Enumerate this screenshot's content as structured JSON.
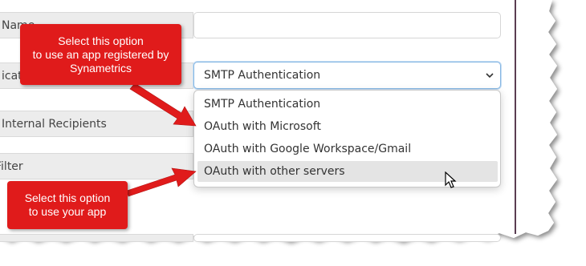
{
  "form": {
    "rows": [
      {
        "label": "Name"
      },
      {
        "label": "ication"
      },
      {
        "label": "Internal Recipients"
      },
      {
        "label": "Filter"
      }
    ]
  },
  "auth_select": {
    "value": "SMTP Authentication",
    "options": [
      "SMTP Authentication",
      "OAuth with Microsoft",
      "OAuth with Google Workspace/Gmail",
      "OAuth with other servers"
    ],
    "highlighted_index": 3
  },
  "callouts": {
    "top": [
      "Select this option",
      "to use an app registered by",
      "Synametrics"
    ],
    "bottom": [
      "Select this option",
      "to use your app"
    ]
  },
  "colors": {
    "callout": "#e01b1b",
    "arrow": "#e01b1b",
    "highlight": "#e4e4e4",
    "focus_border": "#86b7e3"
  },
  "icons": {
    "chevron": "chevron-down-icon",
    "cursor": "mouse-pointer-icon"
  }
}
